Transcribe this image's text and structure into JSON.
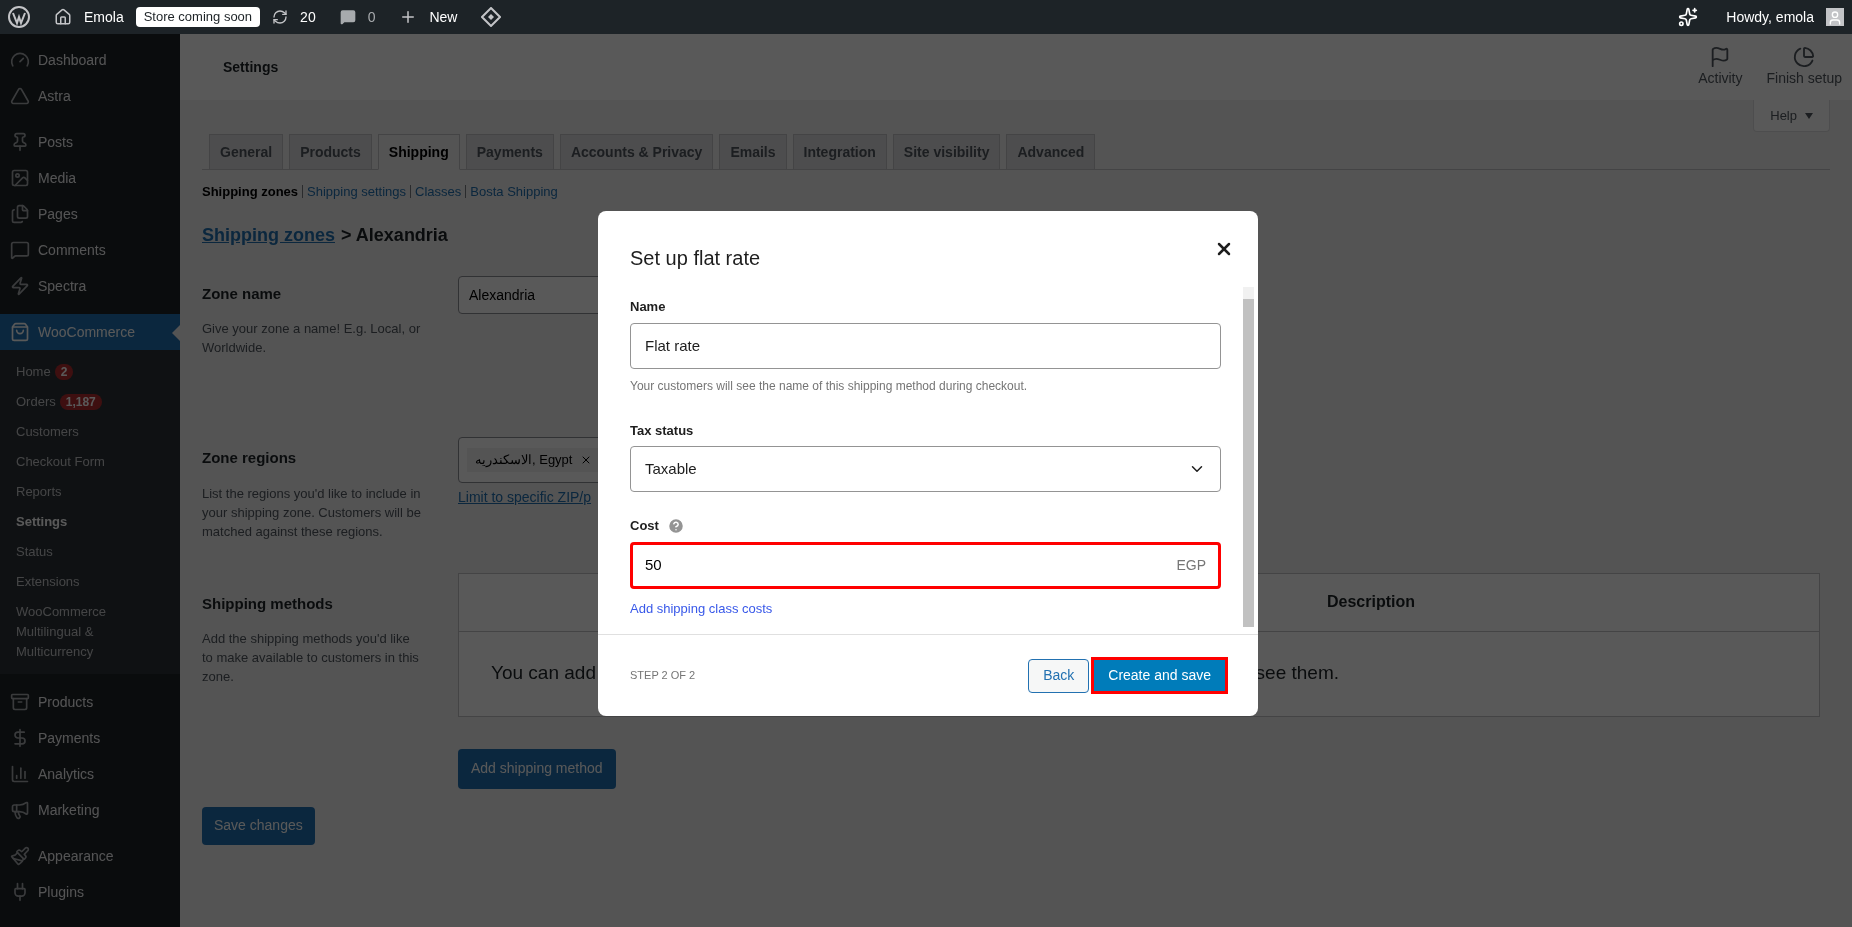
{
  "top_bar": {
    "site_name": "Emola",
    "site_badge": "Store coming soon",
    "updates": "20",
    "comments": "0",
    "new_label": "New",
    "greeting": "Howdy, emola"
  },
  "sidebar": {
    "groups": [
      [
        {
          "label": "Dashboard",
          "selected": false
        },
        {
          "label": "Astra",
          "selected": false
        }
      ],
      [
        {
          "label": "Posts",
          "selected": false
        },
        {
          "label": "Media",
          "selected": false
        },
        {
          "label": "Pages",
          "selected": false
        },
        {
          "label": "Comments",
          "selected": false
        },
        {
          "label": "Spectra",
          "selected": false
        }
      ],
      [
        {
          "label": "WooCommerce",
          "selected": true,
          "children": [
            {
              "label": "Home",
              "badge": "2",
              "selected": false
            },
            {
              "label": "Orders",
              "badge": "1,187",
              "selected": false
            },
            {
              "label": "Customers",
              "selected": false
            },
            {
              "label": "Checkout Form",
              "selected": false
            },
            {
              "label": "Reports",
              "selected": false
            },
            {
              "label": "Settings",
              "selected": true
            },
            {
              "label": "Status",
              "selected": false
            },
            {
              "label": "Extensions",
              "selected": false
            },
            {
              "label": "WooCommerce Multilingual & Multicurrency",
              "selected": false
            }
          ]
        }
      ],
      [
        {
          "label": "Products",
          "selected": false
        },
        {
          "label": "Payments",
          "selected": false
        },
        {
          "label": "Analytics",
          "selected": false
        },
        {
          "label": "Marketing",
          "selected": false
        }
      ],
      [
        {
          "label": "Appearance",
          "selected": false
        },
        {
          "label": "Plugins",
          "selected": false
        }
      ]
    ]
  },
  "header": {
    "title": "Settings",
    "actions": [
      {
        "label": "Activity",
        "kind": "activity"
      },
      {
        "label": "Finish setup",
        "kind": "progress"
      }
    ],
    "help": "Help"
  },
  "tabs": [
    {
      "label": "General",
      "selected": false
    },
    {
      "label": "Products",
      "selected": false
    },
    {
      "label": "Shipping",
      "selected": true
    },
    {
      "label": "Payments",
      "selected": false
    },
    {
      "label": "Accounts & Privacy",
      "selected": false
    },
    {
      "label": "Emails",
      "selected": false
    },
    {
      "label": "Integration",
      "selected": false
    },
    {
      "label": "Site visibility",
      "selected": false
    },
    {
      "label": "Advanced",
      "selected": false
    }
  ],
  "subnav": [
    {
      "label": "Shipping zones",
      "selected": true
    },
    {
      "label": "Shipping settings",
      "selected": false
    },
    {
      "label": "Classes",
      "selected": false
    },
    {
      "label": "Bosta Shipping",
      "selected": false
    }
  ],
  "breadcrumb": {
    "link": "Shipping zones",
    "current": "> Alexandria"
  },
  "zone_name": {
    "title": "Zone name",
    "description": "Give your zone a name! E.g. Local, or Worldwide.",
    "value": "Alexandria"
  },
  "zone_regions": {
    "title": "Zone regions",
    "description": "List the regions you'd like to include in your shipping zone. Customers will be matched against these regions.",
    "tag": "الاسكندريه, Egypt",
    "limit_link": "Limit to specific ZIP/p"
  },
  "shipping_methods": {
    "title": "Shipping methods",
    "description": "Add the shipping methods you'd like to make available to customers in this zone.",
    "column_header": "Description",
    "empty_start": "You can add",
    "empty_end": "see them.",
    "add_button": "Add shipping method"
  },
  "save_button": "Save changes",
  "modal": {
    "title": "Set up flat rate",
    "name_label": "Name",
    "name_value": "Flat rate",
    "name_hint": "Your customers will see the name of this shipping method during checkout.",
    "tax_label": "Tax status",
    "tax_value": "Taxable",
    "cost_label": "Cost",
    "cost_value": "50",
    "cost_suffix": "EGP",
    "cost_highlighted": true,
    "class_costs_link": "Add shipping class costs",
    "step": "STEP 2 OF 2",
    "back": "Back",
    "submit": "Create and save",
    "submit_highlighted": true
  }
}
